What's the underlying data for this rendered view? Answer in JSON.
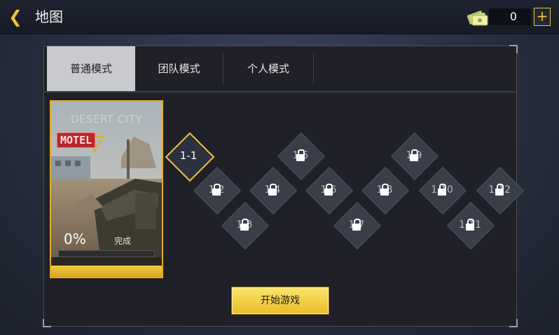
{
  "header": {
    "back_icon": "chevron-left-icon",
    "title": "地图",
    "currency_icon": "cash-stack-icon",
    "currency_amount": "0",
    "plus_label": "+"
  },
  "tabs": [
    {
      "label": "普通模式",
      "active": true
    },
    {
      "label": "团队模式",
      "active": false
    },
    {
      "label": "个人模式",
      "active": false
    }
  ],
  "map_card": {
    "name": "DESERT CITY",
    "sign": "MOTEL",
    "progress_label": "0%",
    "progress_value": 0,
    "status": "完成"
  },
  "levels": [
    {
      "label": "1-1",
      "locked": false
    },
    {
      "label": "1-2",
      "locked": true
    },
    {
      "label": "1-3",
      "locked": true
    },
    {
      "label": "1-4",
      "locked": true
    },
    {
      "label": "1-5",
      "locked": true
    },
    {
      "label": "1-6",
      "locked": true
    },
    {
      "label": "1-7",
      "locked": true
    },
    {
      "label": "1-8",
      "locked": true
    },
    {
      "label": "1-9",
      "locked": true
    },
    {
      "label": "1-10",
      "locked": true
    },
    {
      "label": "1-11",
      "locked": true
    },
    {
      "label": "1-12",
      "locked": true
    }
  ],
  "start_button": "开始游戏",
  "colors": {
    "accent": "#f0c437",
    "panel": "#202128",
    "locked_node": "#3a3e49"
  }
}
